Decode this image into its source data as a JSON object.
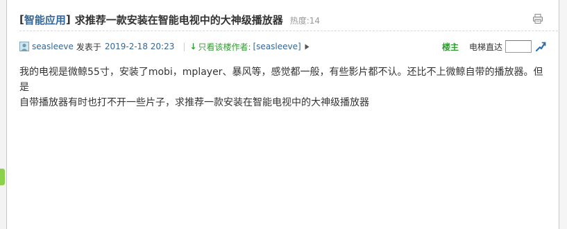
{
  "post": {
    "category_open": "[",
    "category": "智能应用",
    "category_close": "]",
    "title": "求推荐一款安装在智能电视中的大神级播放器",
    "heat_label": "热度:14"
  },
  "meta": {
    "author": "seasleeve",
    "posted_label": "发表于",
    "date": "2019-2-18 20:23",
    "separator": "|",
    "only_author_label": "只看该楼作者:",
    "only_author_name": "[seasleeve]",
    "floor_owner_label": "楼主",
    "elevator_label": "电梯直达",
    "floor_value": ""
  },
  "content": {
    "line1": "我的电视是微鲸55寸，安装了mobi，mplayer、暴风等，感觉都一般，有些影片都不认。还比不上微鲸自带的播放器。但是",
    "line2": "自带播放器有时也打不开一些片子，求推荐一款安装在智能电视中的大神级播放器"
  },
  "icons": {
    "print": "printer-icon",
    "avatar": "avatar-icon",
    "go": "go-icon"
  },
  "colors": {
    "link": "#336699",
    "green": "#339933"
  }
}
